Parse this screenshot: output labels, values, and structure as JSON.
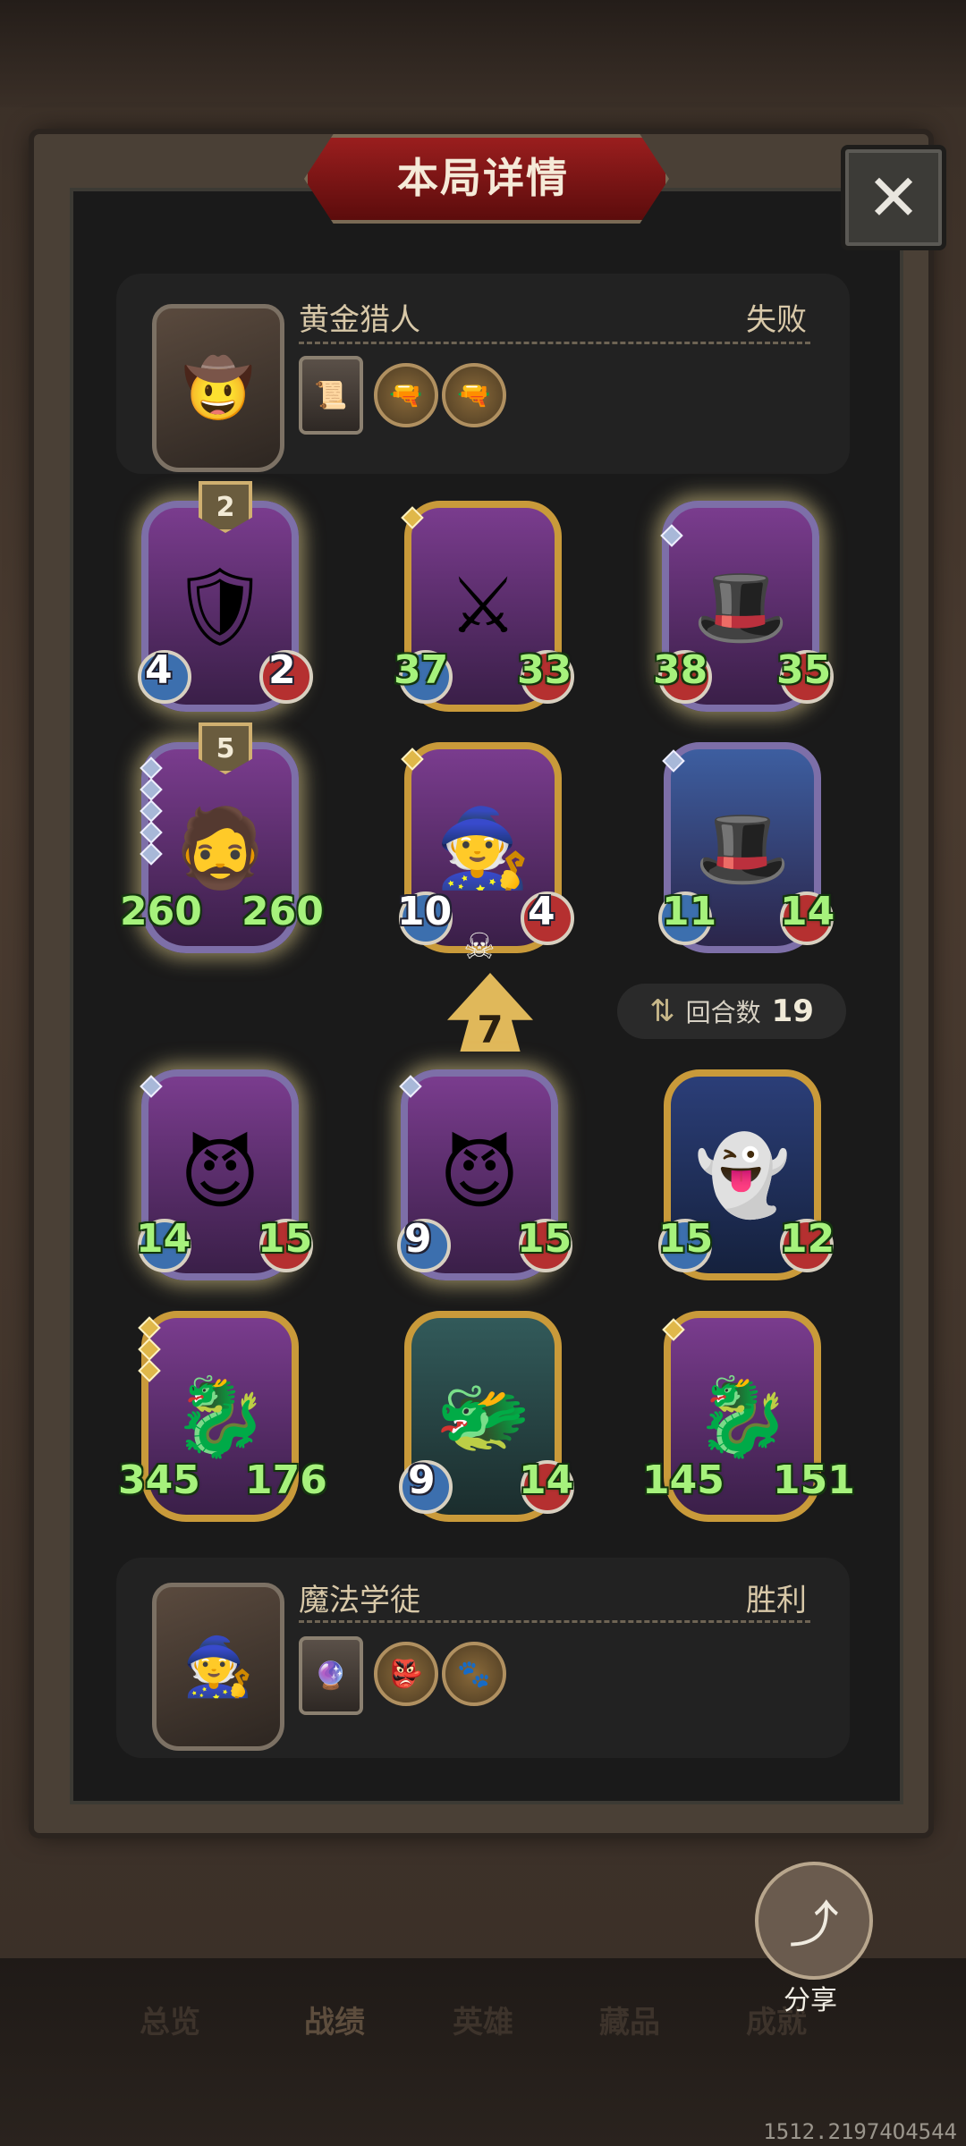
{
  "title": "本局详情",
  "close_label": "✕",
  "top_player": {
    "name": "黄金猎人",
    "result": "失败"
  },
  "bottom_player": {
    "name": "魔法学徒",
    "result": "胜利"
  },
  "opponent_cards": [
    {
      "attack": "4",
      "health": "2",
      "badge": "2",
      "style": "silver"
    },
    {
      "attack": "37",
      "health": "33",
      "badge": "",
      "style": "gold"
    },
    {
      "attack": "38",
      "health": "35",
      "badge": "",
      "style": "silver"
    },
    {
      "attack": "260",
      "health": "260",
      "badge": "5",
      "style": "silver"
    },
    {
      "attack": "10",
      "health": "4",
      "badge": "",
      "style": "gold"
    },
    {
      "attack": "11",
      "health": "14",
      "badge": "",
      "style": "silver"
    }
  ],
  "attack_indicator": "7",
  "round": {
    "label": "回合数",
    "value": "19"
  },
  "player_cards": [
    {
      "attack": "14",
      "health": "15",
      "style": "silver"
    },
    {
      "attack": "9",
      "health": "15",
      "style": "silver"
    },
    {
      "attack": "15",
      "health": "12",
      "style": "gold"
    },
    {
      "attack": "345",
      "health": "176",
      "style": "gold"
    },
    {
      "attack": "9",
      "health": "14",
      "style": "gold"
    },
    {
      "attack": "145",
      "health": "151",
      "style": "gold"
    }
  ],
  "share_label": "分享",
  "nav": [
    "总览",
    "战绩",
    "英雄",
    "藏品",
    "成就"
  ],
  "coords_text": "1512.21974O4544",
  "colors": {
    "stat_green": "#a6f27c",
    "title_red": "#9a1e1e",
    "gold_frame": "#c99a3a",
    "silver_frame": "#7d6fa8"
  }
}
